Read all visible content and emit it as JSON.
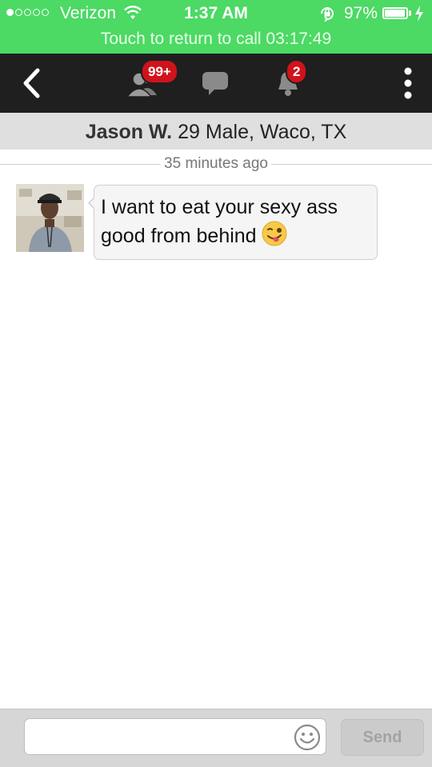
{
  "status_bar": {
    "carrier": "Verizon",
    "time": "1:37 AM",
    "battery_percent": "97%",
    "battery_level": 0.97,
    "signal_bars_filled": 1
  },
  "call_banner": {
    "text": "Touch to return to call  03:17:49"
  },
  "navbar": {
    "friends_badge": "99+",
    "notifications_badge": "2",
    "icons": [
      "back-chevron-icon",
      "friends-icon",
      "chat-bubble-icon",
      "bell-icon",
      "more-vertical-icon"
    ]
  },
  "profile": {
    "name": "Jason W.",
    "details": "29 Male, Waco, TX"
  },
  "conversation": {
    "timestamp": "35 minutes ago",
    "messages": [
      {
        "text": "I want to eat your sexy ass good from behind",
        "emoji": "winking-tongue-face"
      }
    ]
  },
  "composer": {
    "placeholder": "",
    "value": "",
    "send_label": "Send"
  },
  "colors": {
    "status_green": "#4cd964",
    "navbar_bg": "#1f1f1f",
    "badge_red": "#d0131b",
    "header_bg": "#e0dfdf"
  }
}
